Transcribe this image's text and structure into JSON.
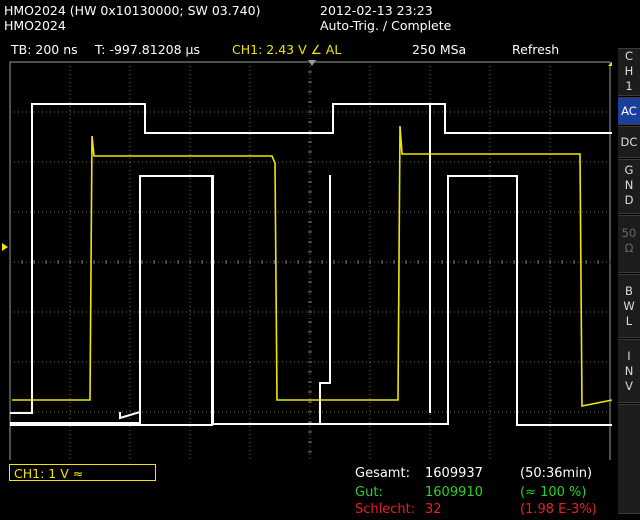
{
  "header": {
    "device_line": "HMO2024 (HW 0x10130000; SW 03.740)",
    "model": "HMO2024",
    "datetime": "2012-02-13 23:23",
    "trigger_state": "Auto-Trig. / Complete"
  },
  "status_bar": {
    "timebase": "TB: 200 ns",
    "trigger_time": "T: -997.81208 µs",
    "trigger_ch": "CH1: 2.43 V ∠ AL",
    "sample_rate": "250 MSa",
    "mode": "Refresh"
  },
  "side_menu": {
    "channel": [
      "C",
      "H",
      "1"
    ],
    "ac": "AC",
    "dc": "DC",
    "gnd": [
      "G",
      "N",
      "D"
    ],
    "fifty": [
      "50",
      "Ω"
    ],
    "bwl": [
      "B",
      "W",
      "L"
    ],
    "inv": [
      "I",
      "N",
      "V"
    ]
  },
  "channel_box": "CH1: 1 V ≈",
  "stats": {
    "total_label": "Gesamt:",
    "total_value": "1609937",
    "total_extra": "(50:36min)",
    "good_label": "Gut:",
    "good_value": "1609910",
    "good_extra": "(≈ 100 %)",
    "bad_label": "Schlecht:",
    "bad_value": "32",
    "bad_extra": "(1.98 E-3%)"
  },
  "colors": {
    "trace_ch1": "#f2e600",
    "mask": "#ffffff",
    "active": "#1c3f9c",
    "good": "#28d228",
    "bad": "#e82020"
  }
}
